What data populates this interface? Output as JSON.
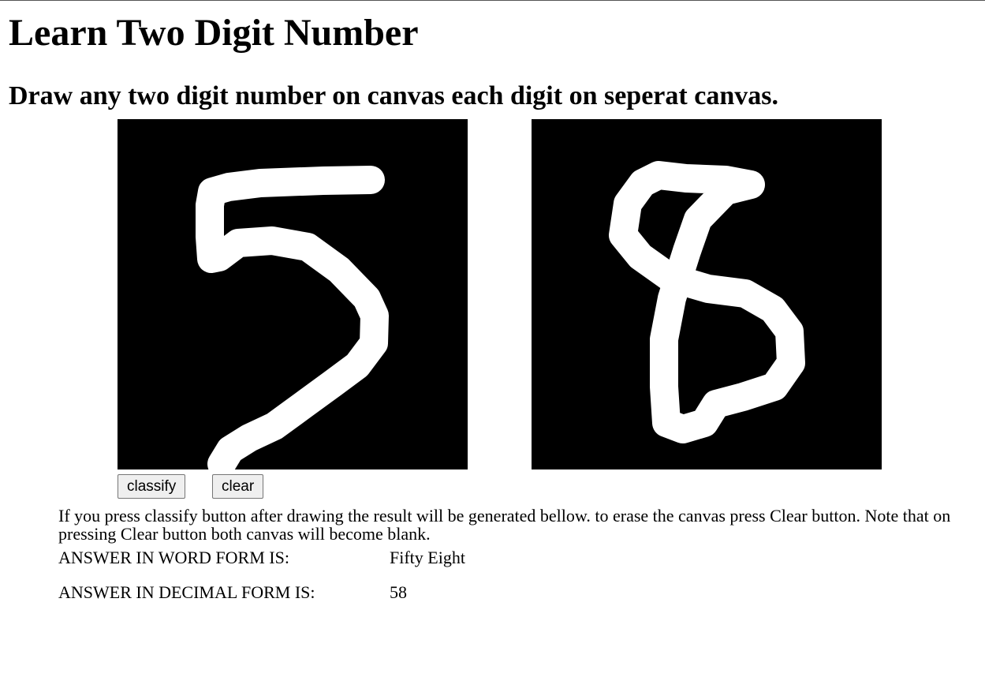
{
  "page": {
    "title": "Learn Two Digit Number",
    "subtitle": "Draw any two digit number on canvas each digit on seperat canvas."
  },
  "canvases": [
    {
      "name": "first-digit-canvas",
      "drawn_digit": "5"
    },
    {
      "name": "second-digit-canvas",
      "drawn_digit": "8"
    }
  ],
  "buttons": {
    "classify_label": "classify",
    "clear_label": "clear"
  },
  "instructions": "If you press classify button after drawing the result will be generated bellow. to erase the canvas press Clear button. Note that on pressing Clear button both canvas will become blank.",
  "answer": {
    "word_label": "ANSWER IN WORD FORM IS:",
    "word_value": "Fifty Eight",
    "decimal_label": "ANSWER IN DECIMAL FORM IS:",
    "decimal_value": "58"
  },
  "colors": {
    "canvas_background": "#000000",
    "stroke": "#ffffff"
  }
}
